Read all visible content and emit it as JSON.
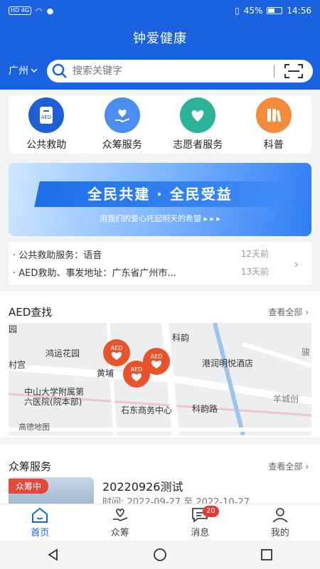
{
  "status": {
    "left_indicators": "HD 4G",
    "battery": "45%",
    "time": "14:56"
  },
  "app": {
    "title": "钟爱健康"
  },
  "search": {
    "city": "广州",
    "placeholder": "搜索关键字"
  },
  "quick_actions": [
    {
      "label": "公共救助",
      "icon": "aed-icon",
      "color": "#1f5fd6"
    },
    {
      "label": "众筹服务",
      "icon": "heart-hand-icon",
      "color": "#4a8df0"
    },
    {
      "label": "志愿者服务",
      "icon": "volunteer-heart-icon",
      "color": "#2bb39a"
    },
    {
      "label": "科普",
      "icon": "books-icon",
      "color": "#f28b3b"
    }
  ],
  "banner": {
    "title": "全民共建 · 全民受益",
    "subtitle": "用我们的爱心托起明天的希望 ▸ ▸ ▸"
  },
  "notices": [
    {
      "text": "· 公共救助服务：语音",
      "time": "12天前"
    },
    {
      "text": "· AED救助、事发地址：广东省广州市...",
      "time": "13天前"
    }
  ],
  "aed": {
    "title": "AED查找",
    "more": "查看全部 ›",
    "map_labels": [
      "鸿运花园",
      "黄埔",
      "港润明悦酒店",
      "中山大学附属第六医院(院本部)",
      "石东商务中心",
      "科韵路",
      "羊城创",
      "村宫",
      "园",
      "骏",
      "科韵",
      "高德地图"
    ],
    "marker_label": "AED"
  },
  "crowdfunding": {
    "title": "众筹服务",
    "more": "查看全部 ›",
    "badge": "众筹中",
    "item_title": "20220926测试",
    "item_time": "时间: 2022-09-27 至 2022-10-27"
  },
  "tabs": [
    {
      "label": "首页",
      "icon": "home-icon",
      "active": true
    },
    {
      "label": "众筹",
      "icon": "heart-hand-icon"
    },
    {
      "label": "消息",
      "icon": "message-icon",
      "badge": "20"
    },
    {
      "label": "我的",
      "icon": "user-icon"
    }
  ],
  "colors": {
    "primary": "#1a63e0",
    "badge": "#e53935",
    "marker": "#e8532b"
  }
}
